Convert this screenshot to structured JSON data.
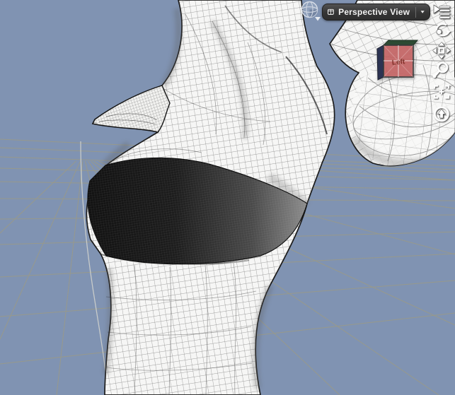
{
  "viewport": {
    "type": "3d-perspective-viewport",
    "background_color": "#8093b2",
    "grid_color": "#9a9a88",
    "axis_line_color": "#d9d9d0",
    "mesh": {
      "content": "wireframe torso with dark chest band, hand pointing left, arm and sphere at right",
      "fill_color": "#f6f6f5",
      "wire_color": "#262626",
      "band_dark_color": "#161616",
      "band_light_color": "#8a8a8a"
    }
  },
  "toolbar": {
    "view_selector": {
      "label": "Perspective View"
    }
  },
  "view_cube": {
    "label": "Left",
    "front_color": "#c96868",
    "left_color": "#2c3352",
    "top_color": "#2d4a33"
  },
  "side_tools": [
    {
      "name": "viewport-options"
    },
    {
      "name": "orbit"
    },
    {
      "name": "pan"
    },
    {
      "name": "dolly-zoom"
    },
    {
      "name": "frame"
    },
    {
      "name": "aim"
    }
  ]
}
